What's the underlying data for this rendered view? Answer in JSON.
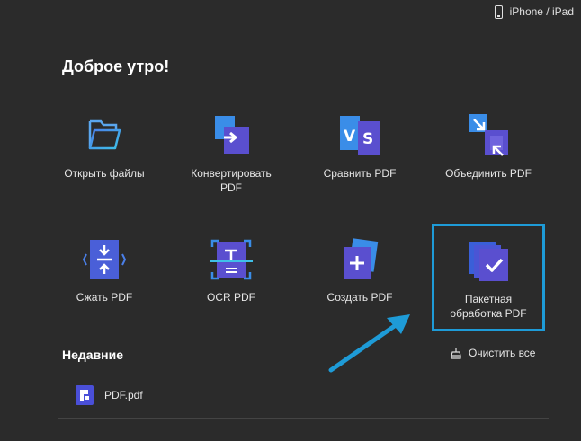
{
  "header": {
    "device_link_label": "iPhone / iPad",
    "device_icon": "smartphone-icon"
  },
  "greeting": "Доброе утро!",
  "tools": [
    {
      "id": "open",
      "label": "Открыть файлы",
      "icon": "folder-icon"
    },
    {
      "id": "convert",
      "label": "Конвертировать\nPDF",
      "icon": "convert-icon"
    },
    {
      "id": "compare",
      "label": "Сравнить PDF",
      "icon": "compare-icon"
    },
    {
      "id": "merge",
      "label": "Объединить PDF",
      "icon": "merge-icon"
    },
    {
      "id": "compress",
      "label": "Сжать PDF",
      "icon": "compress-icon"
    },
    {
      "id": "ocr",
      "label": "OCR PDF",
      "icon": "ocr-icon"
    },
    {
      "id": "create",
      "label": "Создать PDF",
      "icon": "create-icon"
    },
    {
      "id": "batch",
      "label": "Пакетная\nобработка PDF",
      "icon": "batch-icon",
      "highlighted": true
    }
  ],
  "recent": {
    "title": "Недавние",
    "clear_all_label": "Очистить все",
    "clear_icon": "broom-icon",
    "files": [
      {
        "name": "PDF.pdf",
        "icon": "pdf-file-icon"
      }
    ]
  },
  "colors": {
    "background": "#2b2b2b",
    "highlight": "#1e9bd7",
    "accent_blue": "#3b8de6",
    "accent_purple": "#5a4fcf"
  }
}
